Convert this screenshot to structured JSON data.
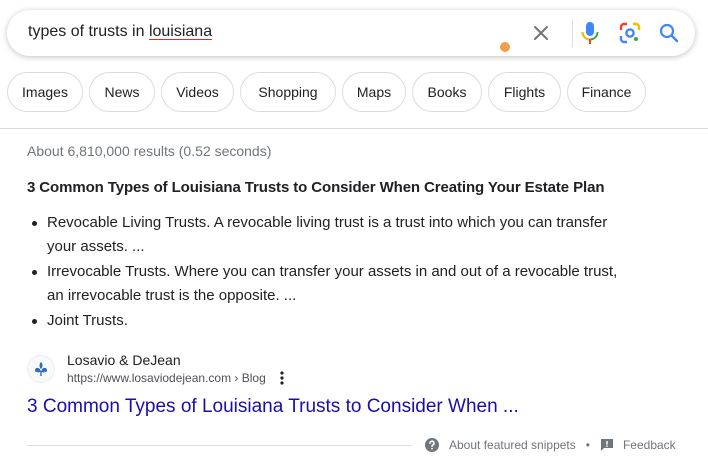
{
  "search": {
    "query_prefix": "types of trusts in ",
    "query_misspelled": "louisiana",
    "icons": [
      "clear-icon",
      "microphone-icon",
      "google-lens-icon",
      "search-icon"
    ]
  },
  "chips": [
    {
      "label": "Images"
    },
    {
      "label": "News"
    },
    {
      "label": "Videos"
    },
    {
      "label": "Shopping"
    },
    {
      "label": "Maps"
    },
    {
      "label": "Books"
    },
    {
      "label": "Flights"
    },
    {
      "label": "Finance"
    }
  ],
  "result_stats": "About 6,810,000 results (0.52 seconds)",
  "featured_snippet": {
    "heading": "3 Common Types of Louisiana Trusts to Consider When Creating Your Estate Plan",
    "items": [
      {
        "line1": "Revocable Living Trusts. A revocable living trust is a trust into which you can transfer",
        "line2": "your assets. ..."
      },
      {
        "line1": "Irrevocable Trusts. Where you can transfer your assets in and out of a revocable trust,",
        "line2": "an irrevocable trust is the opposite. ..."
      },
      {
        "line1": "Joint Trusts.",
        "line2": ""
      }
    ],
    "source": {
      "site_name": "Losavio & DeJean",
      "url": "https://www.losaviodejean.com › Blog",
      "favicon": "fleur-de-lis-icon"
    },
    "link_title": "3 Common Types of Louisiana Trusts to Consider When ..."
  },
  "footer": {
    "about_label": "About featured snippets",
    "separator": "•",
    "feedback_label": "Feedback"
  },
  "colors": {
    "link": "#1a0dab",
    "muted": "#70757a",
    "border": "#dadce0",
    "mic_blue": "#4285f4",
    "mic_red": "#ea4335",
    "search_blue": "#4285f4",
    "dot_orange": "#f29e4c"
  }
}
